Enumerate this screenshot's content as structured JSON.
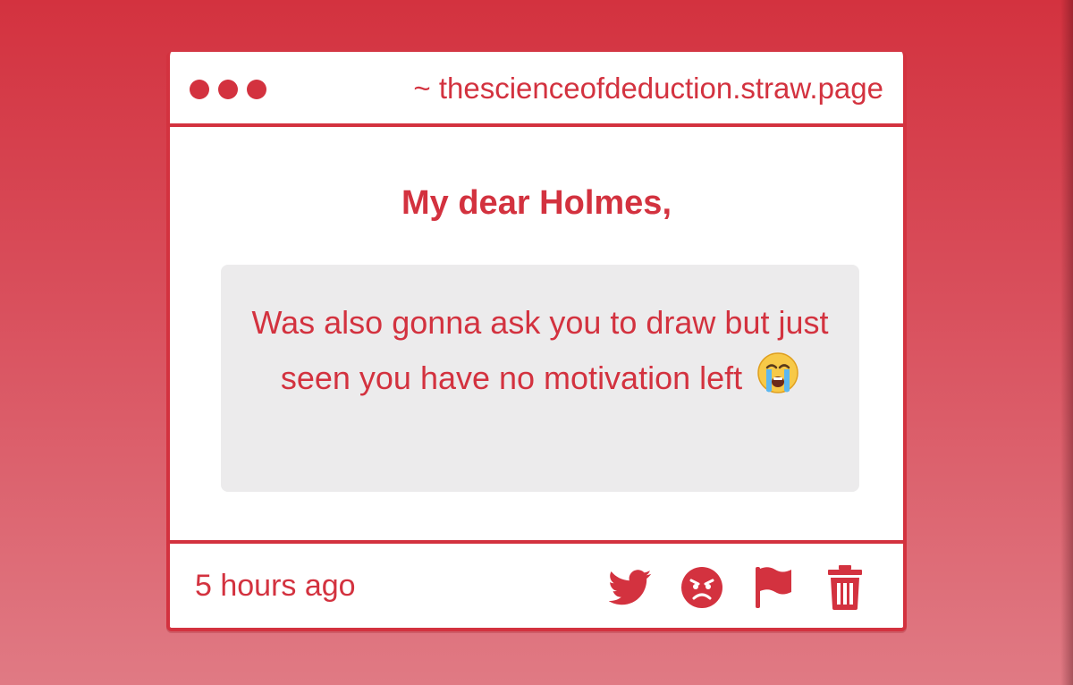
{
  "window": {
    "url_text": "~ thescienceofdeduction.straw.page"
  },
  "letter": {
    "greeting": "My dear Holmes,",
    "message": "Was also gonna ask you to draw but just seen you have no motivation left",
    "emoji_icon": "loudly-crying-face-icon"
  },
  "footer": {
    "timestamp": "5 hours ago",
    "actions": [
      {
        "icon": "twitter-icon"
      },
      {
        "icon": "angry-face-icon"
      },
      {
        "icon": "flag-icon"
      },
      {
        "icon": "trash-icon"
      }
    ]
  },
  "colors": {
    "accent": "#d3323f",
    "message_background": "#ecebec",
    "card_background": "#ffffff"
  }
}
